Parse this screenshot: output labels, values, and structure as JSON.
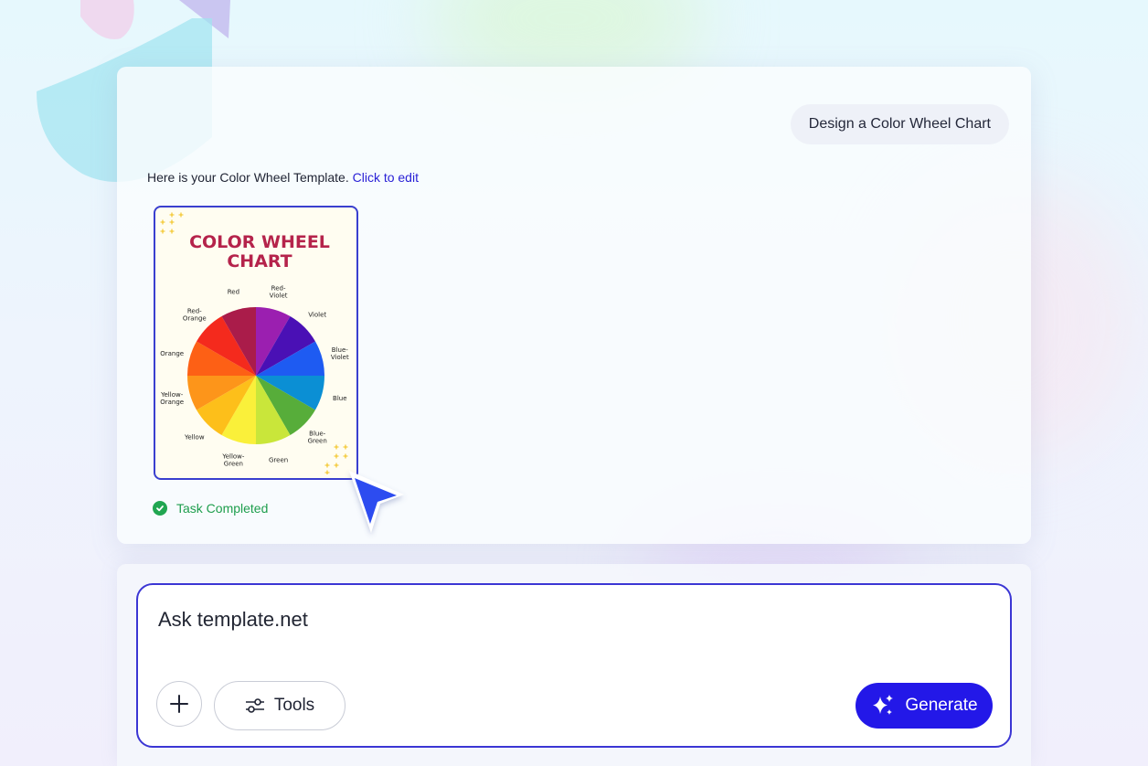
{
  "conversation": {
    "user_prompt": "Design a Color Wheel Chart",
    "reply_text": "Here is your Color Wheel Template.",
    "reply_link": "Click to edit",
    "status_text": "Task Completed"
  },
  "template_preview": {
    "title_line1": "COLOR WHEEL",
    "title_line2": "CHART",
    "wheel_labels": [
      [
        "Red-",
        "Violet"
      ],
      [
        "Violet"
      ],
      [
        "Blue-",
        "Violet"
      ],
      [
        "Blue"
      ],
      [
        "Blue-",
        "Green"
      ],
      [
        "Green"
      ],
      [
        "Yellow-",
        "Green"
      ],
      [
        "Yellow"
      ],
      [
        "Yellow-",
        "Orange"
      ],
      [
        "Orange"
      ],
      [
        "Red-",
        "Orange"
      ],
      [
        "Red"
      ]
    ],
    "wheel_colors": [
      "#9b1fb0",
      "#4a10b5",
      "#1e5bf2",
      "#0b8fd4",
      "#57ad3a",
      "#c9e63a",
      "#faf03a",
      "#fdbf1a",
      "#fd951a",
      "#fd6015",
      "#f42a1d",
      "#aa1c4a"
    ],
    "title_color": "#b5234b",
    "sparkle_color": "#f2c21b"
  },
  "composer": {
    "placeholder": "Ask template.net",
    "tools_label": "Tools",
    "generate_label": "Generate"
  },
  "colors": {
    "accent": "#2318e8",
    "link": "#2a21d6",
    "success": "#21a651"
  }
}
